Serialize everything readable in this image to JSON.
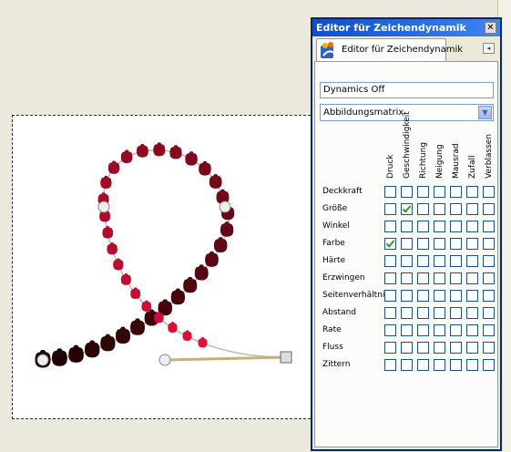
{
  "dialog": {
    "title": "Editor für Zeichendynamik",
    "close_label": "✕",
    "tab_label": "Editor für Zeichendynamik",
    "tab_menu_label": "◂",
    "dynamics_name": "Dynamics Off",
    "mapping_select": {
      "value": "Abbildungsmatrix",
      "arrow": "▼"
    },
    "matrix": {
      "columns": [
        "Druck",
        "Geschwindigkeit",
        "Richtung",
        "Neigung",
        "Mausrad",
        "Zufall",
        "Verblassen"
      ],
      "rows": [
        {
          "label": "Deckkraft",
          "checked": []
        },
        {
          "label": "Größe",
          "checked": [
            1
          ]
        },
        {
          "label": "Winkel",
          "checked": []
        },
        {
          "label": "Farbe",
          "checked": [
            0
          ]
        },
        {
          "label": "Härte",
          "checked": []
        },
        {
          "label": "Erzwingen",
          "checked": []
        },
        {
          "label": "Seitenverhältnis",
          "checked": []
        },
        {
          "label": "Abstand",
          "checked": []
        },
        {
          "label": "Rate",
          "checked": []
        },
        {
          "label": "Fluss",
          "checked": []
        },
        {
          "label": "Zittern",
          "checked": []
        }
      ]
    }
  },
  "colors": {
    "titlebar": "#0a4fd0",
    "stroke_light": "#e0103a",
    "stroke_dark": "#1a0000",
    "check": "#21a121"
  }
}
